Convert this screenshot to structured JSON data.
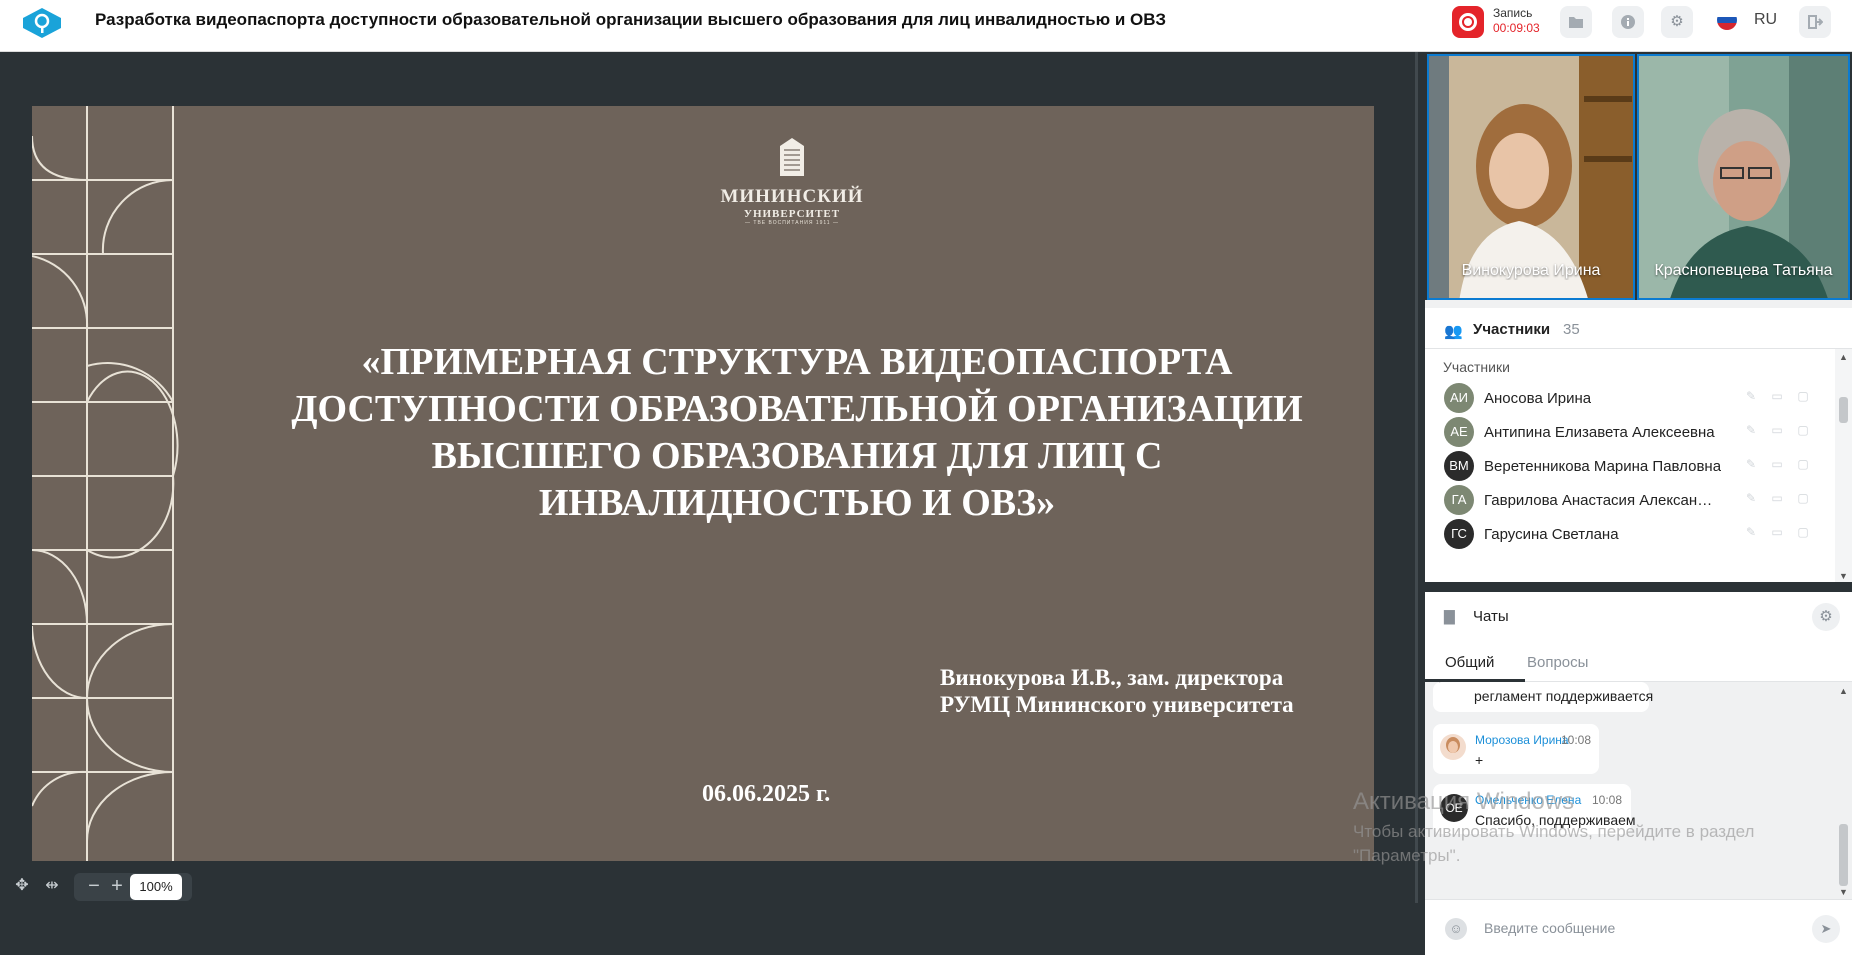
{
  "header": {
    "title": "Разработка видеопаспорта доступности образовательной организации высшего образования для лиц инвалидностью и ОВЗ",
    "record_label": "Запись",
    "record_time": "00:09:03",
    "language": "RU",
    "icons": [
      "app-logo-icon",
      "record-icon",
      "folder-icon",
      "info-icon",
      "gear-icon",
      "flag-icon",
      "exit-icon"
    ]
  },
  "slide": {
    "logo_line1": "МИНИНСКИЙ",
    "logo_line2": "УНИВЕРСИТЕТ",
    "logo_line3": "— ТВЕ ВОСПИТАНИЯ 1911 —",
    "title_lines": [
      "«ПРИМЕРНАЯ СТРУКТУРА ВИДЕОПАСПОРТА",
      "ДОСТУПНОСТИ ОБРАЗОВАТЕЛЬНОЙ ОРГАНИЗАЦИИ",
      "ВЫСШЕГО ОБРАЗОВАНИЯ ДЛЯ ЛИЦ С",
      "ИНВАЛИДНОСТЬЮ И ОВЗ»"
    ],
    "author_line1": "Винокурова И.В., зам. директора",
    "author_line2": "РУМЦ Мининского университета",
    "date": "06.06.2025 г."
  },
  "zoom": {
    "value": "100%",
    "zoom_out": "−",
    "zoom_in": "+"
  },
  "videos": [
    {
      "name": "Винокурова Ирина"
    },
    {
      "name": "Краснопевцева Татьяна"
    }
  ],
  "participants": {
    "header_label": "Участники",
    "count": "35",
    "section_label": "Участники",
    "items": [
      {
        "initials": "АИ",
        "name": "Аносова Ирина",
        "color": "#7d8873"
      },
      {
        "initials": "АЕ",
        "name": "Антипина Елизавета Алексеевна",
        "color": "#7d8873"
      },
      {
        "initials": "ВМ",
        "name": "Веретенникова Марина Павловна",
        "color": "#2b2b2b"
      },
      {
        "initials": "ГА",
        "name": "Гаврилова Анастасия Александровна",
        "color": "#7d8873"
      },
      {
        "initials": "ГС",
        "name": "Гарусина Светлана",
        "color": "#2b2b2b"
      }
    ]
  },
  "chat": {
    "header_label": "Чаты",
    "tabs": [
      "Общий",
      "Вопросы"
    ],
    "messages": [
      {
        "text": "регламент поддерживается"
      },
      {
        "author": "Морозова Ирина",
        "time": "10:08",
        "text": "+"
      },
      {
        "initials": "ОЕ",
        "author": "Омельченко Елена",
        "time": "10:08",
        "text": "Спасибо, поддерживаем"
      }
    ],
    "input_placeholder": "Введите сообщение"
  },
  "watermark": {
    "line1": "Активация Windows",
    "line2": "Чтобы активировать Windows, перейдите в раздел \"Параметры\"."
  }
}
